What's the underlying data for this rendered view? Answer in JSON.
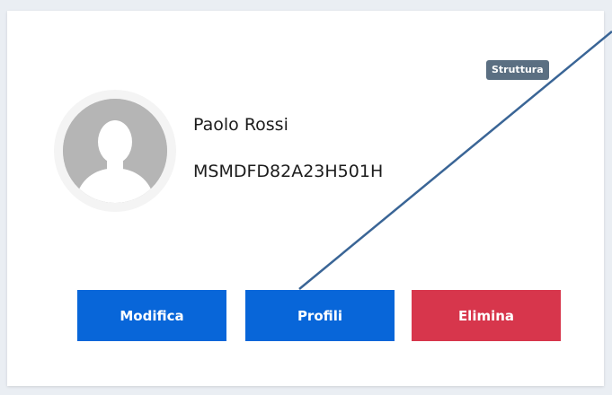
{
  "user": {
    "name": "Paolo Rossi",
    "fiscal_code": "MSMDFD82A23H501H",
    "badge": "Struttura"
  },
  "actions": {
    "edit_label": "Modifica",
    "profiles_label": "Profili",
    "delete_label": "Elimina"
  },
  "icons": {
    "avatar": "user-silhouette-icon"
  },
  "colors": {
    "primary": "#0866d9",
    "danger": "#d7364c",
    "badge": "#5b6f82",
    "annotation_arrow": "#3a6596"
  }
}
